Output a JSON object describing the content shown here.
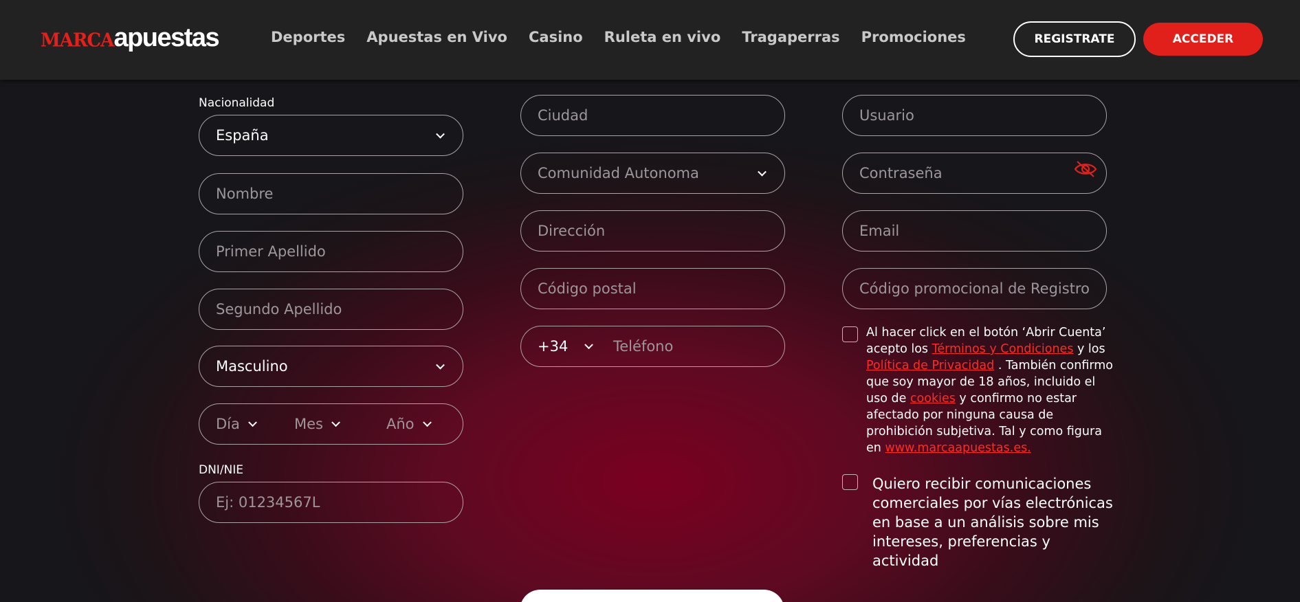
{
  "header": {
    "logo_part1": "MARCA",
    "logo_part2": "apuestas",
    "nav": [
      "Deportes",
      "Apuestas en Vivo",
      "Casino",
      "Ruleta en vivo",
      "Tragaperras",
      "Promociones"
    ],
    "register_label": "REGISTRATE",
    "login_label": "ACCEDER"
  },
  "form": {
    "nationality_label": "Nacionalidad",
    "nationality_value": "España",
    "first_name_placeholder": "Nombre",
    "last_name1_placeholder": "Primer Apellido",
    "last_name2_placeholder": "Segundo Apellido",
    "gender_value": "Masculino",
    "day_placeholder": "Día",
    "month_placeholder": "Mes",
    "year_placeholder": "Año",
    "dni_label": "DNI/NIE",
    "dni_placeholder": "Ej: 01234567L",
    "city_placeholder": "Ciudad",
    "region_placeholder": "Comunidad Autonoma",
    "address_placeholder": "Dirección",
    "postal_placeholder": "Código postal",
    "phone_prefix": "+34",
    "phone_placeholder": "Teléfono",
    "user_placeholder": "Usuario",
    "password_placeholder": "Contraseña",
    "email_placeholder": "Email",
    "promo_placeholder": "Código promocional de Registro"
  },
  "terms": {
    "text1": "Al hacer click en el botón ‘Abrir Cuenta’ acepto los ",
    "link_terms": "Términos y Condiciones",
    "text2": " y los ",
    "link_privacy": "Política de Privacidad",
    "text3": " . También confirmo que soy mayor de 18 años, incluido el uso de ",
    "link_cookies": "cookies",
    "text4": " y confirmo no estar afectado por ninguna causa de prohibición subjetiva. Tal y como figura en ",
    "link_site": "www.marcaapuestas.es."
  },
  "marketing": {
    "text": "Quiero recibir comunicaciones comerciales por vías electrónicas en base a un análisis sobre mis intereses, preferencias y actividad"
  },
  "colors": {
    "accent": "#e1201b",
    "header_bg": "#222222",
    "link": "#ff2a24"
  }
}
